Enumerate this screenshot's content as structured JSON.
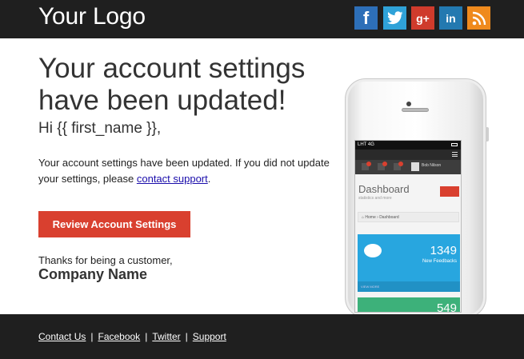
{
  "header": {
    "logo": "Your Logo",
    "social": [
      {
        "name": "facebook",
        "glyph": "f",
        "color": "#2d6fb8"
      },
      {
        "name": "twitter",
        "glyph": "🐦",
        "color": "#2fa2d8"
      },
      {
        "name": "google-plus",
        "glyph": "g+",
        "color": "#cf3b2c"
      },
      {
        "name": "linkedin",
        "glyph": "in",
        "color": "#2379b0"
      },
      {
        "name": "rss",
        "glyph": "◉",
        "color": "#ef8a1d"
      }
    ]
  },
  "main": {
    "headline": "Your account settings have been updated!",
    "greeting": "Hi {{ first_name }},",
    "body_prefix": "Your account settings have been updated. If you did not update your settings, please ",
    "body_link": "contact support",
    "body_suffix": ".",
    "cta": "Review Account Settings",
    "thanks": "Thanks for being a customer,",
    "company": "Company Name"
  },
  "phone": {
    "status": "LHT 4G",
    "user": "Bob Nilson",
    "dashboard_title": "Dashboard",
    "dashboard_sub": "statistics and more",
    "breadcrumb": "⌂ Home › Dashboard",
    "feedback_count": "1349",
    "feedback_label": "New Feedbacks",
    "view_more": "VIEW MORE",
    "second_count": "549"
  },
  "footer": {
    "links": [
      "Contact Us",
      "Facebook",
      "Twitter",
      "Support"
    ]
  },
  "colors": {
    "header_bg": "#1f1f1f",
    "cta_bg": "#d9402f"
  }
}
